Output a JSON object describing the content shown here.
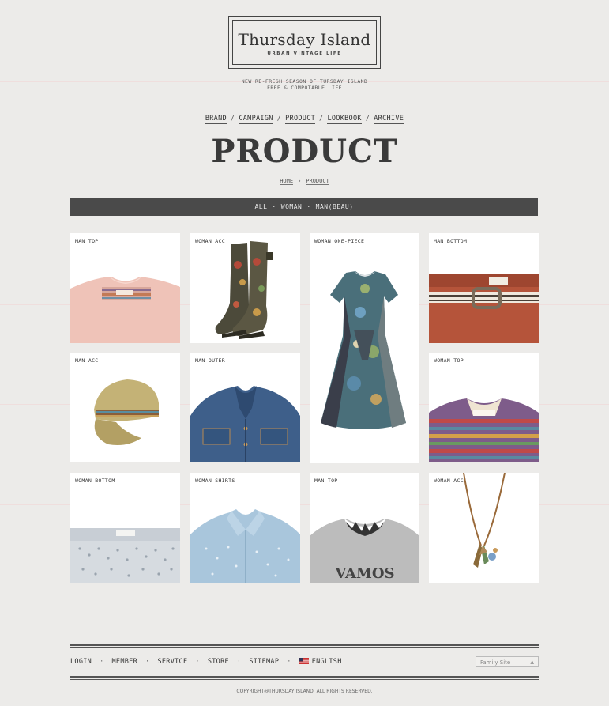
{
  "logo": {
    "title": "Thursday Island",
    "subtitle": "URBAN VINTAGE LIFE"
  },
  "tagline": {
    "line1": "NEW RE-FRESH SEASON OF TURSDAY ISLAND",
    "line2": "FREE & COMPOTABLE LIFE"
  },
  "nav": {
    "items": [
      "BRAND",
      "CAMPAIGN",
      "PRODUCT",
      "LOOKBOOK",
      "ARCHIVE"
    ],
    "separator": "/"
  },
  "page_title": "PRODUCT",
  "breadcrumb": {
    "home": "HOME",
    "arrow": "›",
    "current": "PRODUCT"
  },
  "filter": {
    "items": [
      "ALL",
      "WOMAN",
      "MAN(BEAU)"
    ],
    "separator": "·"
  },
  "products": [
    {
      "label": "MAN TOP",
      "image": "pink-tshirt"
    },
    {
      "label": "WOMAN ACC",
      "image": "floral-rain-boots"
    },
    {
      "label": "WOMAN ONE-PIECE",
      "image": "floral-dress"
    },
    {
      "label": "MAN BOTTOM",
      "image": "rust-pants-with-belt"
    },
    {
      "label": "MAN ACC",
      "image": "khaki-cap"
    },
    {
      "label": "MAN OUTER",
      "image": "denim-jacket"
    },
    {
      "label": "WOMAN TOP",
      "image": "striped-knit-cardigan"
    },
    {
      "label": "WOMAN BOTTOM",
      "image": "eyelet-shorts"
    },
    {
      "label": "WOMAN SHIRTS",
      "image": "dotted-blue-shirt"
    },
    {
      "label": "MAN TOP",
      "image": "grey-sweatshirt"
    },
    {
      "label": "WOMAN ACC",
      "image": "feather-necklace"
    }
  ],
  "product_graphic_text": "VAMOS",
  "footer": {
    "links": [
      "LOGIN",
      "MEMBER",
      "SERVICE",
      "STORE",
      "SITEMAP"
    ],
    "language": "ENGLISH",
    "separator": "·",
    "family_site": "Family Site",
    "copyright": "COPYRIGHT@THURSDAY ISLAND. ALL RIGHTS RESERVED."
  },
  "colors": {
    "background": "#ecebe9",
    "filter_bar": "#4a4a4a",
    "text": "#333333"
  }
}
